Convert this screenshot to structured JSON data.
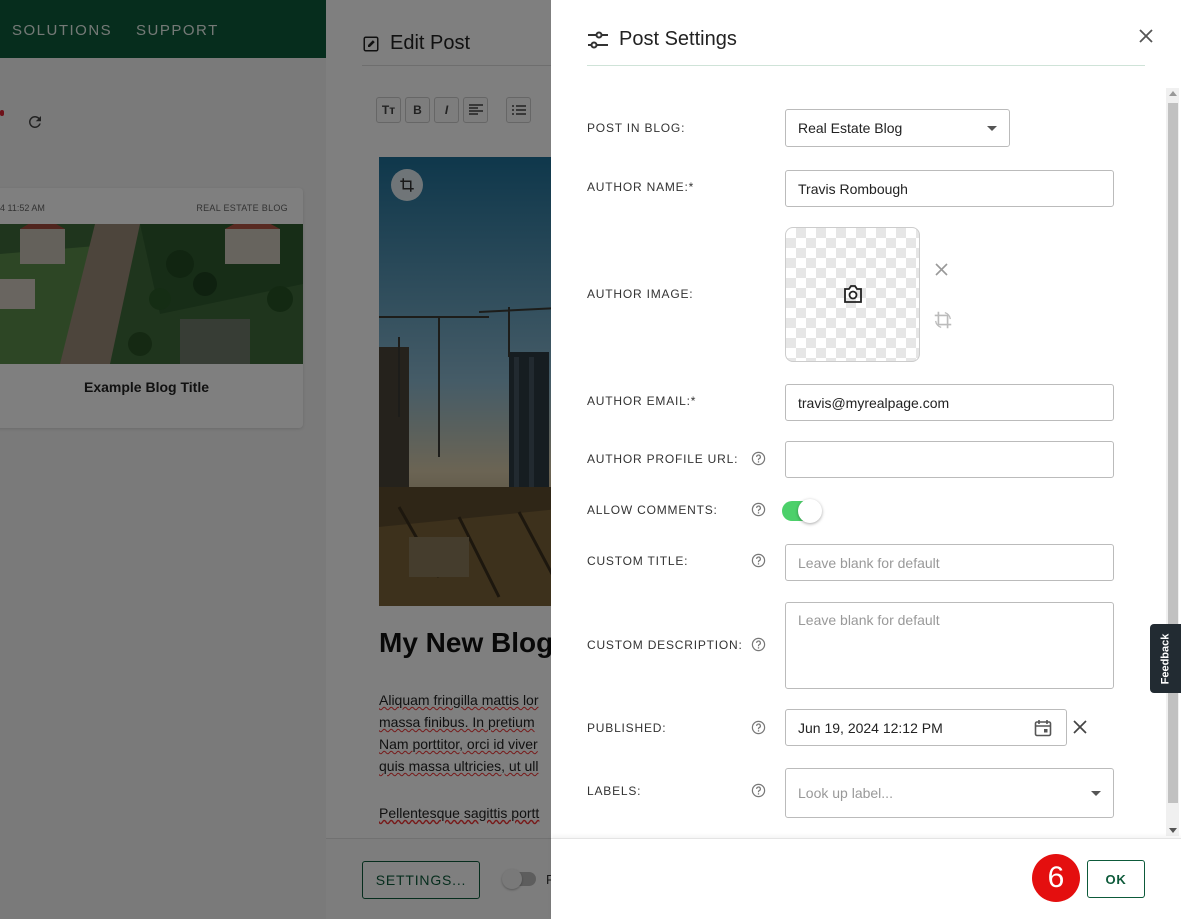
{
  "background": {
    "nav": {
      "solutions": "SOLUTIONS",
      "support": "SUPPORT"
    },
    "card": {
      "date": "4 11:52 AM",
      "blog": "REAL ESTATE BLOG",
      "title": "Example Blog Title"
    }
  },
  "editor": {
    "title": "Edit Post",
    "toolbar": [
      "Tт",
      "B",
      "I"
    ],
    "heading": "My New Blog",
    "paragraph": [
      "Aliquam fringilla mattis lor",
      "massa finibus. In pretium",
      "Nam porttitor, orci id viver",
      "quis massa ultricies, ut ull"
    ],
    "paragraph2": "Pellentesque sagittis portt",
    "settings_button": "SETTINGS...",
    "toggle_letter": "F"
  },
  "panel": {
    "title": "Post Settings",
    "fields": {
      "post_in_blog": {
        "label": "POST IN BLOG:",
        "value": "Real Estate Blog"
      },
      "author_name": {
        "label": "AUTHOR NAME:*",
        "value": "Travis Rombough"
      },
      "author_image": {
        "label": "AUTHOR IMAGE:"
      },
      "author_email": {
        "label": "AUTHOR EMAIL:*",
        "value": "travis@myrealpage.com"
      },
      "author_profile_url": {
        "label": "AUTHOR PROFILE URL:",
        "value": ""
      },
      "allow_comments": {
        "label": "ALLOW COMMENTS:",
        "enabled": true
      },
      "custom_title": {
        "label": "CUSTOM TITLE:",
        "placeholder": "Leave blank for default"
      },
      "custom_description": {
        "label": "CUSTOM DESCRIPTION:",
        "placeholder": "Leave blank for default"
      },
      "published": {
        "label": "PUBLISHED:",
        "value": "Jun 19, 2024 12:12 PM"
      },
      "labels": {
        "label": "LABELS:",
        "placeholder": "Look up label..."
      }
    },
    "step_badge": "6",
    "ok_button": "OK"
  },
  "feedback_tab": "Feedback",
  "colors": {
    "brand_green": "#0d5a3a",
    "toggle_on": "#4cd06a",
    "step_badge": "#e40f0f"
  }
}
